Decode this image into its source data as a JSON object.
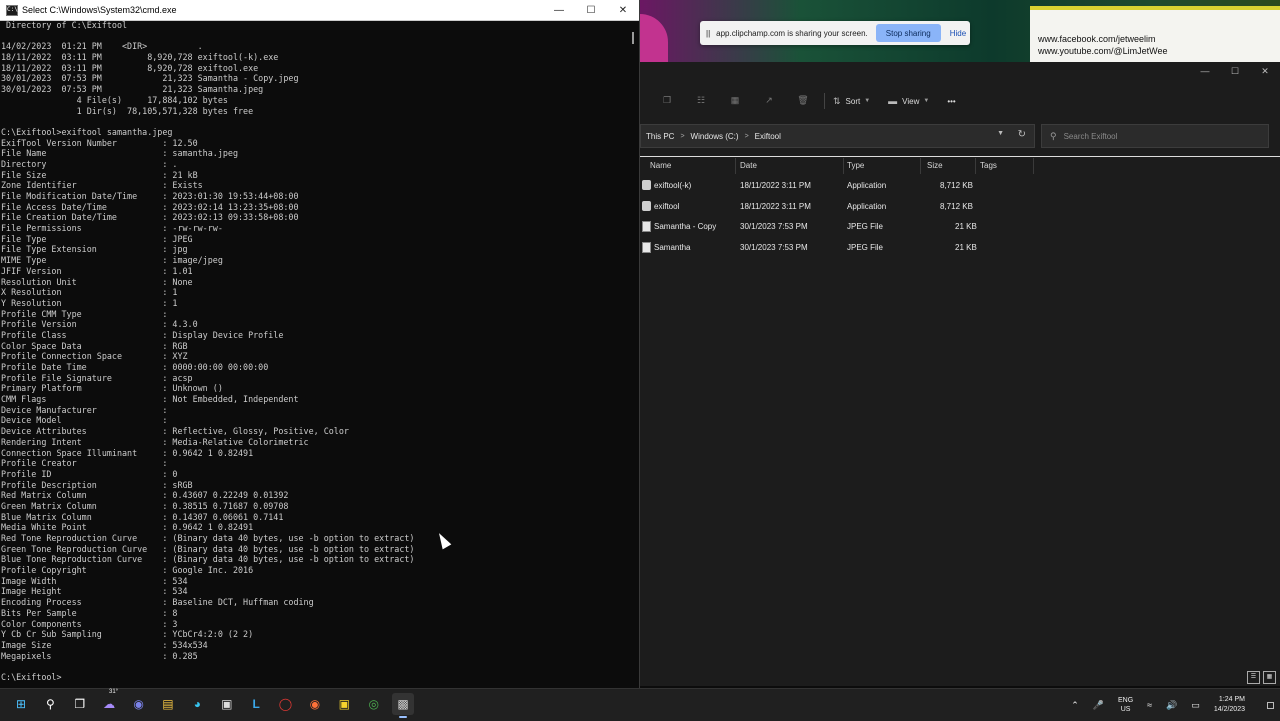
{
  "cmd": {
    "title": "Select C:\\Windows\\System32\\cmd.exe",
    "lines": [
      " Directory of C:\\Exiftool",
      "",
      "14/02/2023  01:21 PM    <DIR>          .",
      "18/11/2022  03:11 PM         8,920,728 exiftool(-k).exe",
      "18/11/2022  03:11 PM         8,920,728 exiftool.exe",
      "30/01/2023  07:53 PM            21,323 Samantha - Copy.jpeg",
      "30/01/2023  07:53 PM            21,323 Samantha.jpeg",
      "               4 File(s)     17,884,102 bytes",
      "               1 Dir(s)  78,105,571,328 bytes free",
      "",
      "C:\\Exiftool>exiftool samantha.jpeg",
      "ExifTool Version Number         : 12.50",
      "File Name                       : samantha.jpeg",
      "Directory                       : .",
      "File Size                       : 21 kB",
      "Zone Identifier                 : Exists",
      "File Modification Date/Time     : 2023:01:30 19:53:44+08:00",
      "File Access Date/Time           : 2023:02:14 13:23:35+08:00",
      "File Creation Date/Time         : 2023:02:13 09:33:58+08:00",
      "File Permissions                : -rw-rw-rw-",
      "File Type                       : JPEG",
      "File Type Extension             : jpg",
      "MIME Type                       : image/jpeg",
      "JFIF Version                    : 1.01",
      "Resolution Unit                 : None",
      "X Resolution                    : 1",
      "Y Resolution                    : 1",
      "Profile CMM Type                : ",
      "Profile Version                 : 4.3.0",
      "Profile Class                   : Display Device Profile",
      "Color Space Data                : RGB",
      "Profile Connection Space        : XYZ",
      "Profile Date Time               : 0000:00:00 00:00:00",
      "Profile File Signature          : acsp",
      "Primary Platform                : Unknown ()",
      "CMM Flags                       : Not Embedded, Independent",
      "Device Manufacturer             : ",
      "Device Model                    : ",
      "Device Attributes               : Reflective, Glossy, Positive, Color",
      "Rendering Intent                : Media-Relative Colorimetric",
      "Connection Space Illuminant     : 0.9642 1 0.82491",
      "Profile Creator                 : ",
      "Profile ID                      : 0",
      "Profile Description             : sRGB",
      "Red Matrix Column               : 0.43607 0.22249 0.01392",
      "Green Matrix Column             : 0.38515 0.71687 0.09708",
      "Blue Matrix Column              : 0.14307 0.06061 0.7141",
      "Media White Point               : 0.9642 1 0.82491",
      "Red Tone Reproduction Curve     : (Binary data 40 bytes, use -b option to extract)",
      "Green Tone Reproduction Curve   : (Binary data 40 bytes, use -b option to extract)",
      "Blue Tone Reproduction Curve    : (Binary data 40 bytes, use -b option to extract)",
      "Profile Copyright               : Google Inc. 2016",
      "Image Width                     : 534",
      "Image Height                    : 534",
      "Encoding Process                : Baseline DCT, Huffman coding",
      "Bits Per Sample                 : 8",
      "Color Components                : 3",
      "Y Cb Cr Sub Sampling            : YCbCr4:2:0 (2 2)",
      "Image Size                      : 534x534",
      "Megapixels                      : 0.285",
      "",
      "C:\\Exiftool>"
    ]
  },
  "share_bar": {
    "pause_glyph": "||",
    "message": "app.clipchamp.com is sharing your screen.",
    "stop_label": "Stop sharing",
    "hide_label": "Hide"
  },
  "social": {
    "facebook": "www.facebook.com/jetweelim",
    "youtube": "www.youtube.com/@LimJetWee"
  },
  "explorer": {
    "toolbar": {
      "sort_label": "Sort",
      "view_label": "View",
      "more_glyph": "•••"
    },
    "breadcrumb": [
      "This PC",
      "Windows (C:)",
      "Exiftool"
    ],
    "search_placeholder": "Search Exiftool",
    "columns": [
      "Name",
      "Date",
      "Type",
      "Size",
      "Tags"
    ],
    "files": [
      {
        "name": "exiftool(-k)",
        "date": "18/11/2022 3:11 PM",
        "type": "Application",
        "size": "8,712 KB",
        "icon": "application-icon"
      },
      {
        "name": "exiftool",
        "date": "18/11/2022 3:11 PM",
        "type": "Application",
        "size": "8,712 KB",
        "icon": "application-icon"
      },
      {
        "name": "Samantha - Copy",
        "date": "30/1/2023 7:53 PM",
        "type": "JPEG File",
        "size": "21 KB",
        "icon": "jpeg-file-icon"
      },
      {
        "name": "Samantha",
        "date": "30/1/2023 7:53 PM",
        "type": "JPEG File",
        "size": "21 KB",
        "icon": "jpeg-file-icon"
      }
    ]
  },
  "taskbar": {
    "weather": "31°",
    "lang_line1": "ENG",
    "lang_line2": "US",
    "time": "1:24 PM",
    "date": "14/2/2023"
  },
  "colors": {
    "console_bg": "#0c0c0c",
    "console_text": "#cccccc",
    "explorer_bg": "#1c1c1c",
    "accent": "#8ab4f8",
    "taskbar_bg": "#202020"
  }
}
